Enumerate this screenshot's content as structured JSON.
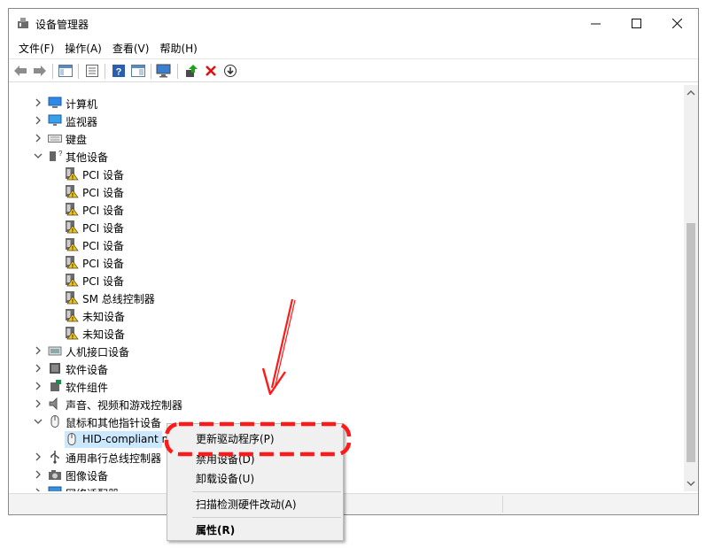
{
  "window": {
    "title": "设备管理器",
    "min_glyph": "—",
    "max_glyph": "☐",
    "close_glyph": "✕"
  },
  "menu": [
    "文件(F)",
    "操作(A)",
    "查看(V)",
    "帮助(H)"
  ],
  "tree": [
    {
      "label": "计算机",
      "level": 0,
      "expanded": false,
      "icon": "computer-icon"
    },
    {
      "label": "监视器",
      "level": 0,
      "expanded": false,
      "icon": "monitor-icon"
    },
    {
      "label": "键盘",
      "level": 0,
      "expanded": false,
      "icon": "keyboard-icon"
    },
    {
      "label": "其他设备",
      "level": 0,
      "expanded": true,
      "icon": "other-devices-icon"
    },
    {
      "label": "PCI 设备",
      "level": 1,
      "icon": "warning-device-icon"
    },
    {
      "label": "PCI 设备",
      "level": 1,
      "icon": "warning-device-icon"
    },
    {
      "label": "PCI 设备",
      "level": 1,
      "icon": "warning-device-icon"
    },
    {
      "label": "PCI 设备",
      "level": 1,
      "icon": "warning-device-icon"
    },
    {
      "label": "PCI 设备",
      "level": 1,
      "icon": "warning-device-icon"
    },
    {
      "label": "PCI 设备",
      "level": 1,
      "icon": "warning-device-icon"
    },
    {
      "label": "PCI 设备",
      "level": 1,
      "icon": "warning-device-icon"
    },
    {
      "label": "SM 总线控制器",
      "level": 1,
      "icon": "warning-device-icon"
    },
    {
      "label": "未知设备",
      "level": 1,
      "icon": "warning-device-icon"
    },
    {
      "label": "未知设备",
      "level": 1,
      "icon": "warning-device-icon"
    },
    {
      "label": "人机接口设备",
      "level": 0,
      "expanded": false,
      "icon": "hid-icon"
    },
    {
      "label": "软件设备",
      "level": 0,
      "expanded": false,
      "icon": "software-device-icon"
    },
    {
      "label": "软件组件",
      "level": 0,
      "expanded": false,
      "icon": "software-component-icon"
    },
    {
      "label": "声音、视频和游戏控制器",
      "level": 0,
      "expanded": false,
      "icon": "speaker-icon"
    },
    {
      "label": "鼠标和其他指针设备",
      "level": 0,
      "expanded": true,
      "icon": "mouse-icon"
    },
    {
      "label": "HID-compliant m",
      "level": 1,
      "icon": "mouse-icon",
      "selected": true
    },
    {
      "label": "通用串行总线控制器",
      "level": 0,
      "expanded": false,
      "icon": "usb-icon"
    },
    {
      "label": "图像设备",
      "level": 0,
      "expanded": false,
      "icon": "camera-icon"
    },
    {
      "label": "网络适配器",
      "level": 0,
      "expanded": false,
      "icon": "network-icon"
    }
  ],
  "context_menu": {
    "update_driver": "更新驱动程序(P)",
    "disable_device": "禁用设备(D)",
    "uninstall_device": "卸载设备(U)",
    "scan_hardware": "扫描检测硬件改动(A)",
    "properties": "属性(R)"
  },
  "colors": {
    "annotation_red": "#ff1a1a",
    "selection_bg": "#cce8ff"
  }
}
